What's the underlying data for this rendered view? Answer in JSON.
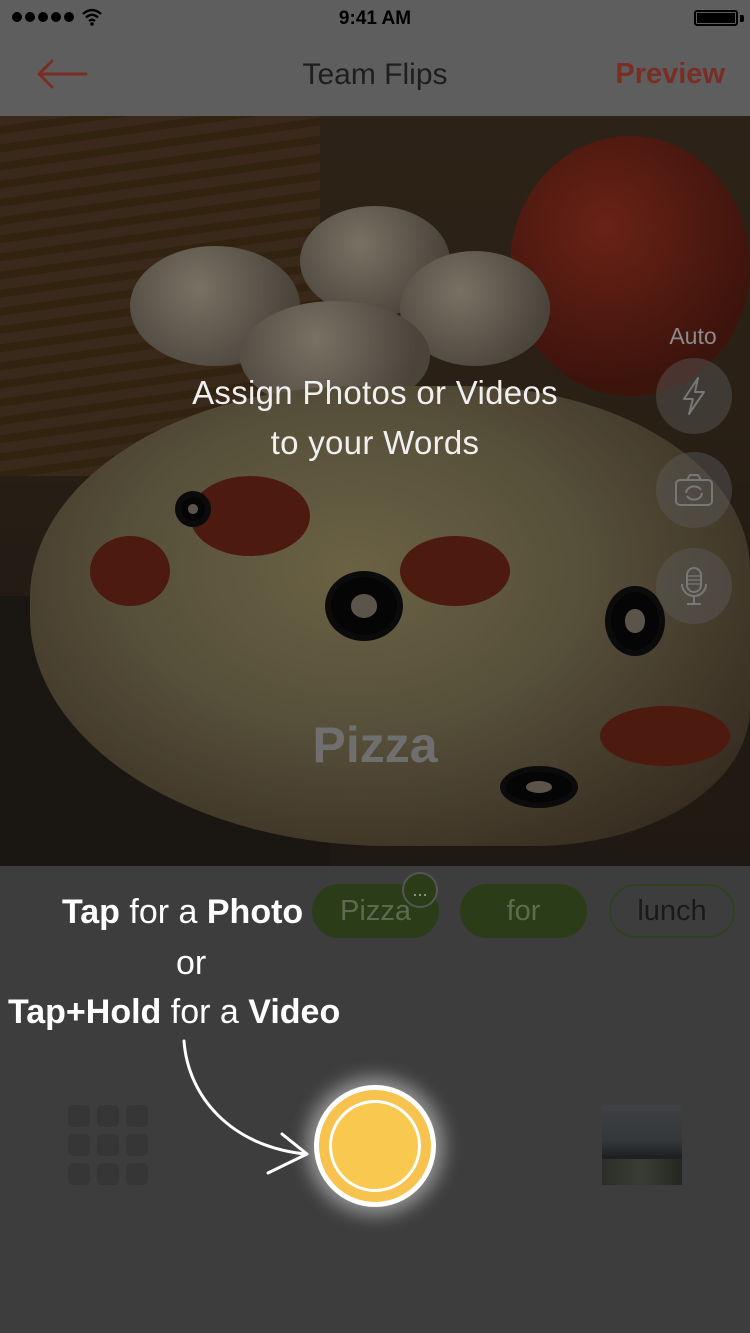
{
  "status_bar": {
    "time": "9:41 AM"
  },
  "nav": {
    "title": "Team Flips",
    "preview_label": "Preview"
  },
  "camera": {
    "instruction_line1": "Assign Photos or Videos",
    "instruction_line2": "to your Words",
    "current_word": "Pizza",
    "flash_mode": "Auto",
    "icons": [
      "flash-icon",
      "flip-camera-icon",
      "microphone-icon"
    ]
  },
  "words": [
    {
      "label": "Pizza",
      "state": "assigned",
      "more": "..."
    },
    {
      "label": "for",
      "state": "assigned"
    },
    {
      "label": "lunch",
      "state": "empty"
    }
  ],
  "hint": {
    "tap": "Tap",
    "for_a_1": " for a ",
    "photo": "Photo",
    "or": "or",
    "tap_hold": "Tap+Hold",
    "for_a_2": " for a ",
    "video": "Video"
  },
  "colors": {
    "accent": "#7a2e23",
    "shutter": "#f7c24e",
    "word_chip": "#2b3d18"
  }
}
